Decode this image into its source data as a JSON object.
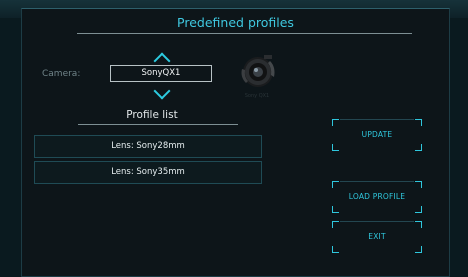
{
  "header": {
    "title": "Predefined profiles"
  },
  "camera": {
    "label": "Camera:",
    "selected": "SonyQX1",
    "image_caption": "Sony QX1"
  },
  "profile_list": {
    "title": "Profile list",
    "items": [
      {
        "label": "Lens: Sony28mm"
      },
      {
        "label": "Lens: Sony35mm"
      }
    ]
  },
  "buttons": {
    "update": "UPDATE",
    "load_profile": "LOAD PROFILE",
    "exit": "EXIT"
  },
  "colors": {
    "accent": "#2fc7dd",
    "title": "#3fc8e0",
    "background": "#0d1519"
  }
}
